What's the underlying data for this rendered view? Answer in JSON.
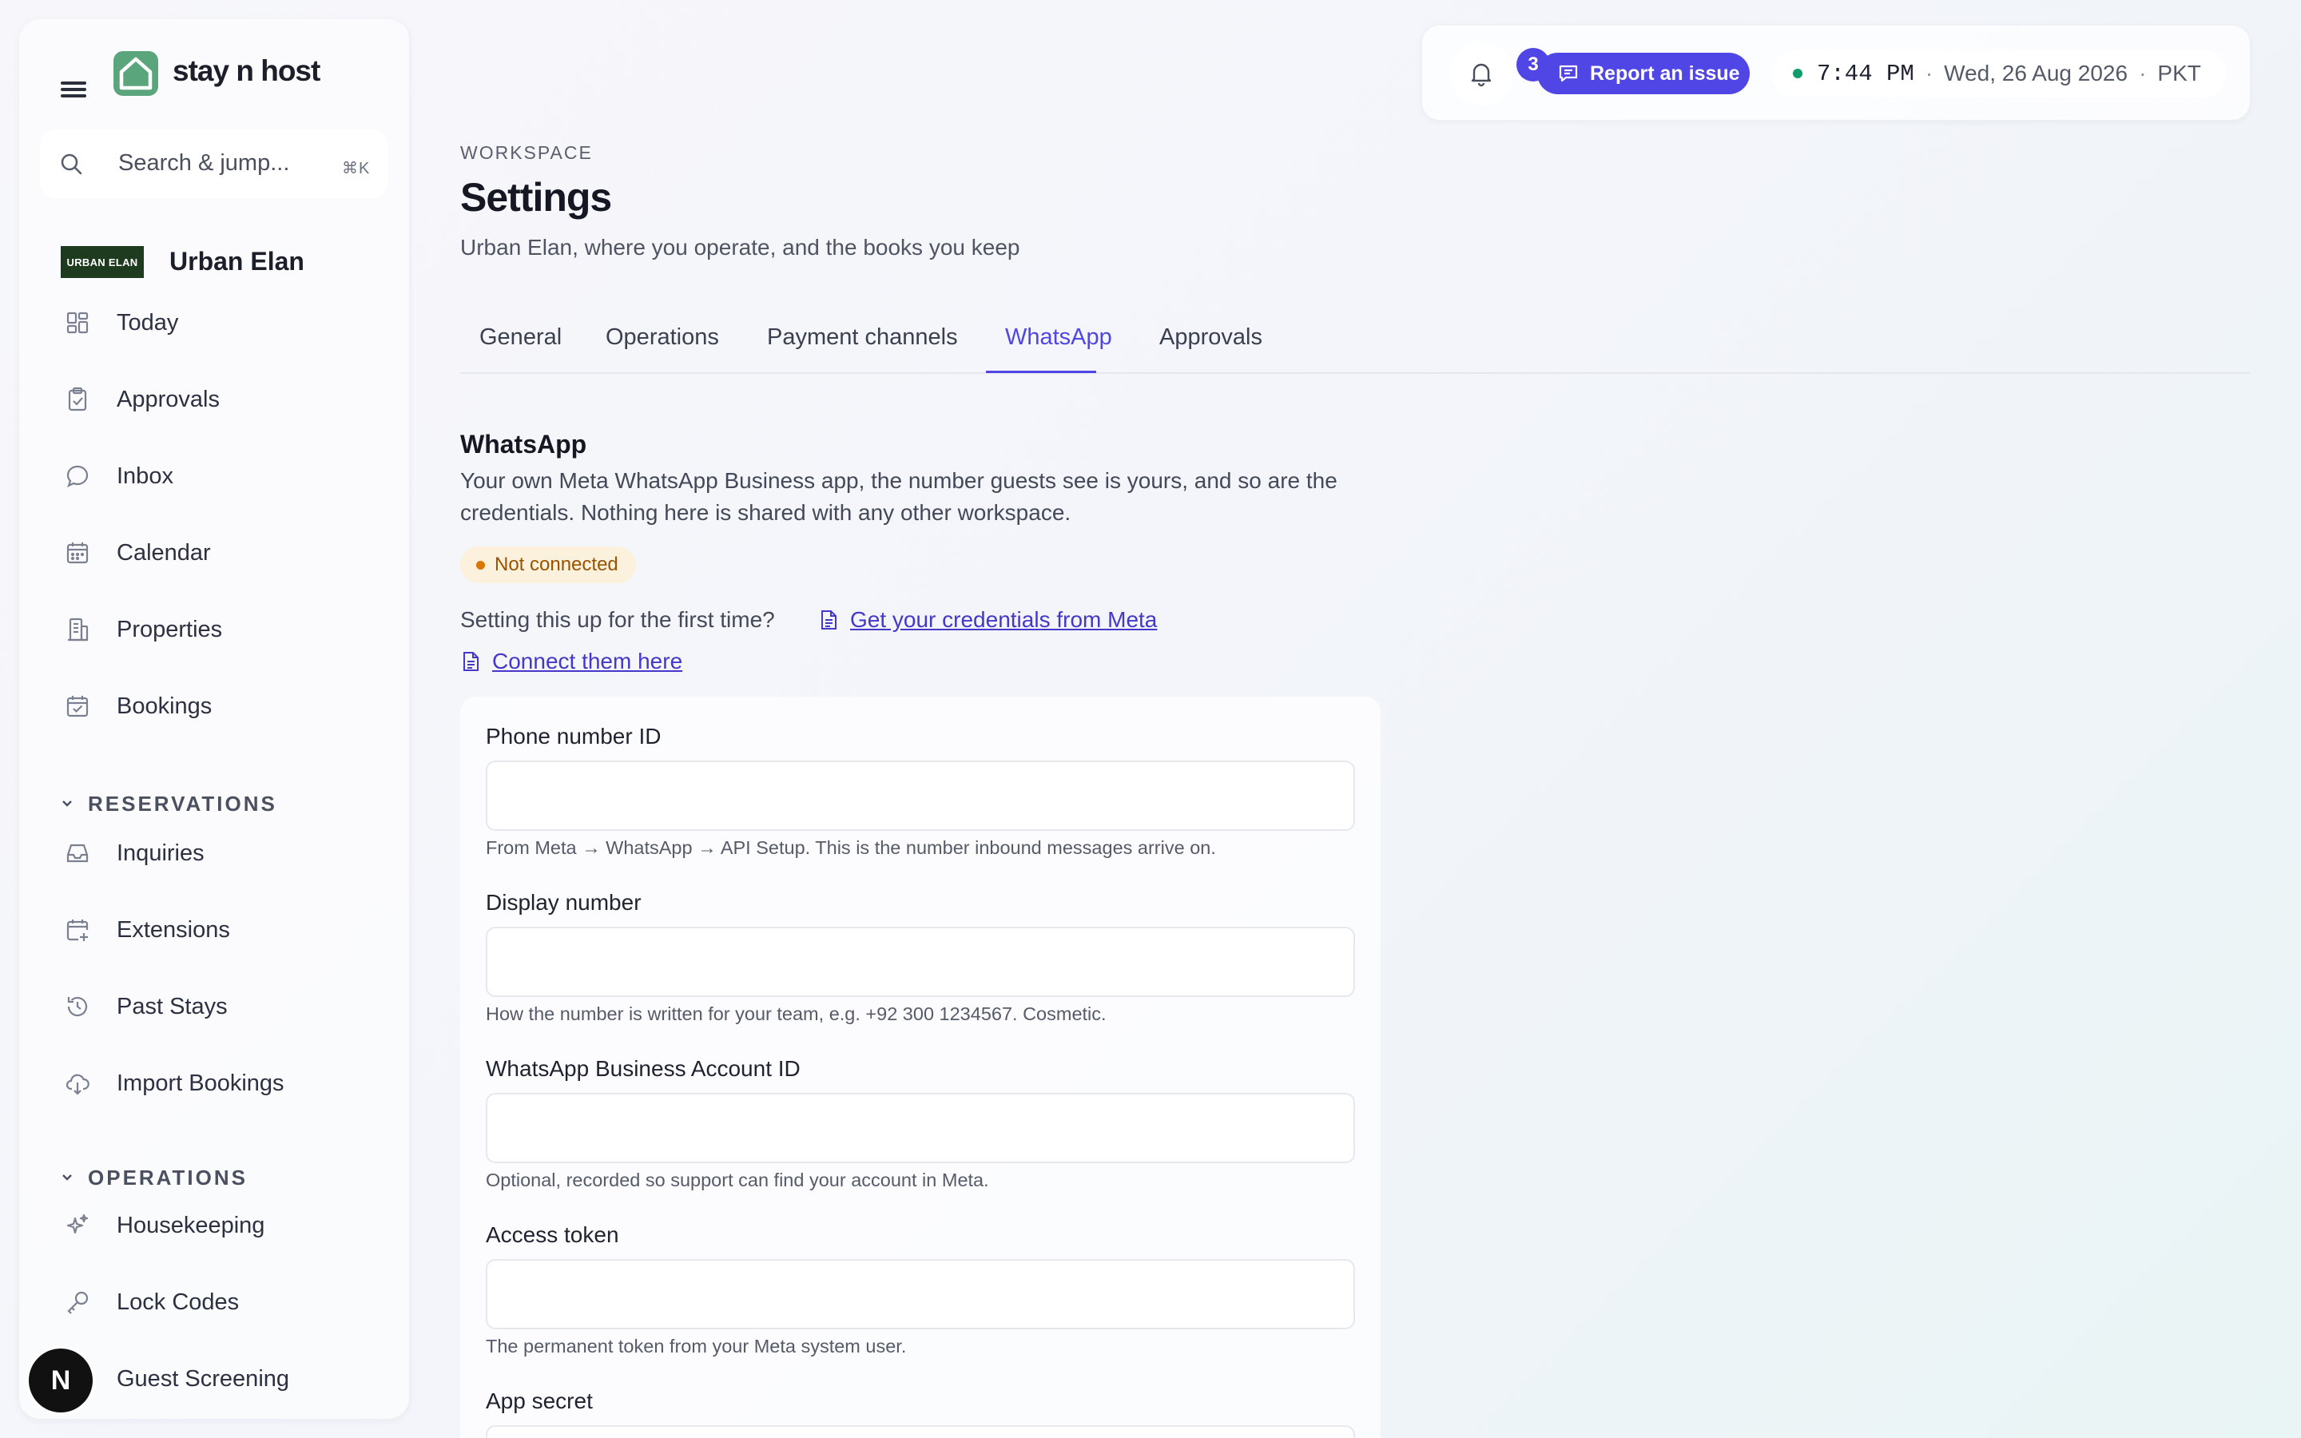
{
  "brand": {
    "name": "stay n host"
  },
  "search": {
    "placeholder": "Search & jump...",
    "shortcut": "⌘K"
  },
  "workspace": {
    "logo_text": "URBAN ELAN",
    "name": "Urban Elan"
  },
  "nav": {
    "main": [
      {
        "label": "Today",
        "icon": "dashboard-icon"
      },
      {
        "label": "Approvals",
        "icon": "clipboard-check-icon"
      },
      {
        "label": "Inbox",
        "icon": "chat-bubble-icon"
      },
      {
        "label": "Calendar",
        "icon": "calendar-icon"
      },
      {
        "label": "Properties",
        "icon": "building-icon"
      },
      {
        "label": "Bookings",
        "icon": "calendar-check-icon"
      }
    ],
    "reservations": {
      "heading": "RESERVATIONS",
      "items": [
        {
          "label": "Inquiries",
          "icon": "inbox-tray-icon"
        },
        {
          "label": "Extensions",
          "icon": "calendar-plus-icon"
        },
        {
          "label": "Past Stays",
          "icon": "history-icon"
        },
        {
          "label": "Import Bookings",
          "icon": "cloud-download-icon"
        }
      ]
    },
    "operations": {
      "heading": "OPERATIONS",
      "items": [
        {
          "label": "Housekeeping",
          "icon": "sparkles-icon"
        },
        {
          "label": "Lock Codes",
          "icon": "key-icon"
        },
        {
          "label": "Guest Screening",
          "icon": "shield-icon"
        }
      ]
    }
  },
  "avatar": {
    "initial": "N"
  },
  "topbar": {
    "notification_count": "3",
    "report_label": "Report an issue",
    "time": "7:44 PM",
    "date": "Wed, 26 Aug 2026",
    "timezone": "PKT",
    "separator": "·"
  },
  "page": {
    "eyebrow": "WORKSPACE",
    "title": "Settings",
    "subtitle": "Urban Elan, where you operate, and the books you keep"
  },
  "tabs": [
    {
      "label": "General"
    },
    {
      "label": "Operations"
    },
    {
      "label": "Payment channels"
    },
    {
      "label": "WhatsApp",
      "active": true
    },
    {
      "label": "Approvals"
    }
  ],
  "whatsapp": {
    "title": "WhatsApp",
    "description": "Your own Meta WhatsApp Business app, the number guests see is yours, and so are the credentials. Nothing here is shared with any other workspace.",
    "status": "Not connected",
    "setup_prompt": "Setting this up for the first time?",
    "link_credentials": "Get your credentials from Meta",
    "link_connect": "Connect them here",
    "fields": [
      {
        "label": "Phone number ID",
        "value": "",
        "hint": "From Meta → WhatsApp → API Setup. This is the number inbound messages arrive on."
      },
      {
        "label": "Display number",
        "value": "",
        "hint": "How the number is written for your team, e.g. +92 300 1234567. Cosmetic."
      },
      {
        "label": "WhatsApp Business Account ID",
        "value": "",
        "hint": "Optional, recorded so support can find your account in Meta."
      },
      {
        "label": "Access token",
        "value": "",
        "hint": "The permanent token from your Meta system user."
      },
      {
        "label": "App secret",
        "value": ""
      }
    ]
  },
  "colors": {
    "accent": "#4f46e5",
    "brand_green": "#5aa57c",
    "warning_bg": "#fbf1dc",
    "warning_text": "#9a5200",
    "online": "#0f9d6b"
  }
}
